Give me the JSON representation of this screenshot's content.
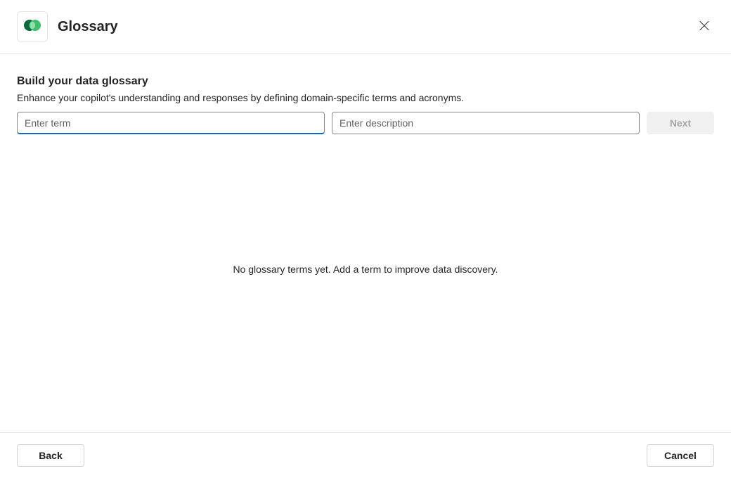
{
  "header": {
    "title": "Glossary"
  },
  "main": {
    "heading": "Build your data glossary",
    "subheading": "Enhance your copilot's understanding and responses by defining domain-specific terms and acronyms.",
    "term_placeholder": "Enter term",
    "description_placeholder": "Enter description",
    "next_label": "Next",
    "empty_state": "No glossary terms yet. Add a term to improve data discovery."
  },
  "footer": {
    "back_label": "Back",
    "cancel_label": "Cancel"
  }
}
